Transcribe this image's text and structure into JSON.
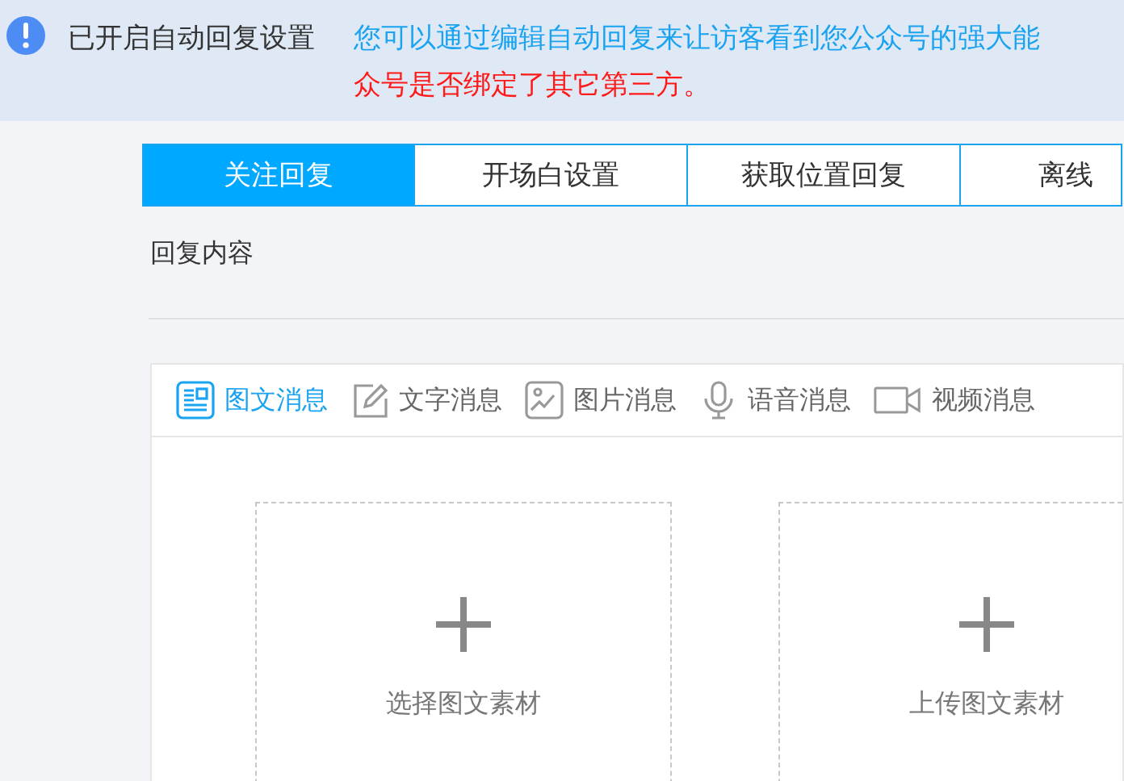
{
  "banner": {
    "title": "已开启自动回复设置",
    "notice_text": "您可以通过编辑自动回复来让访客看到您公众号的强大能",
    "warning_text": "众号是否绑定了其它第三方。"
  },
  "tabs": [
    {
      "label": "关注回复",
      "selected": true
    },
    {
      "label": "开场白设置",
      "selected": false
    },
    {
      "label": "获取位置回复",
      "selected": false
    },
    {
      "label": "离线",
      "selected": false
    }
  ],
  "section_label": "回复内容",
  "message_types": [
    {
      "kind": "news",
      "label": "图文消息",
      "selected": true
    },
    {
      "kind": "text",
      "label": "文字消息",
      "selected": false
    },
    {
      "kind": "image",
      "label": "图片消息",
      "selected": false
    },
    {
      "kind": "voice",
      "label": "语音消息",
      "selected": false
    },
    {
      "kind": "video",
      "label": "视频消息",
      "selected": false
    }
  ],
  "upload_cards": [
    {
      "label": "选择图文素材"
    },
    {
      "label": "上传图文素材"
    }
  ]
}
